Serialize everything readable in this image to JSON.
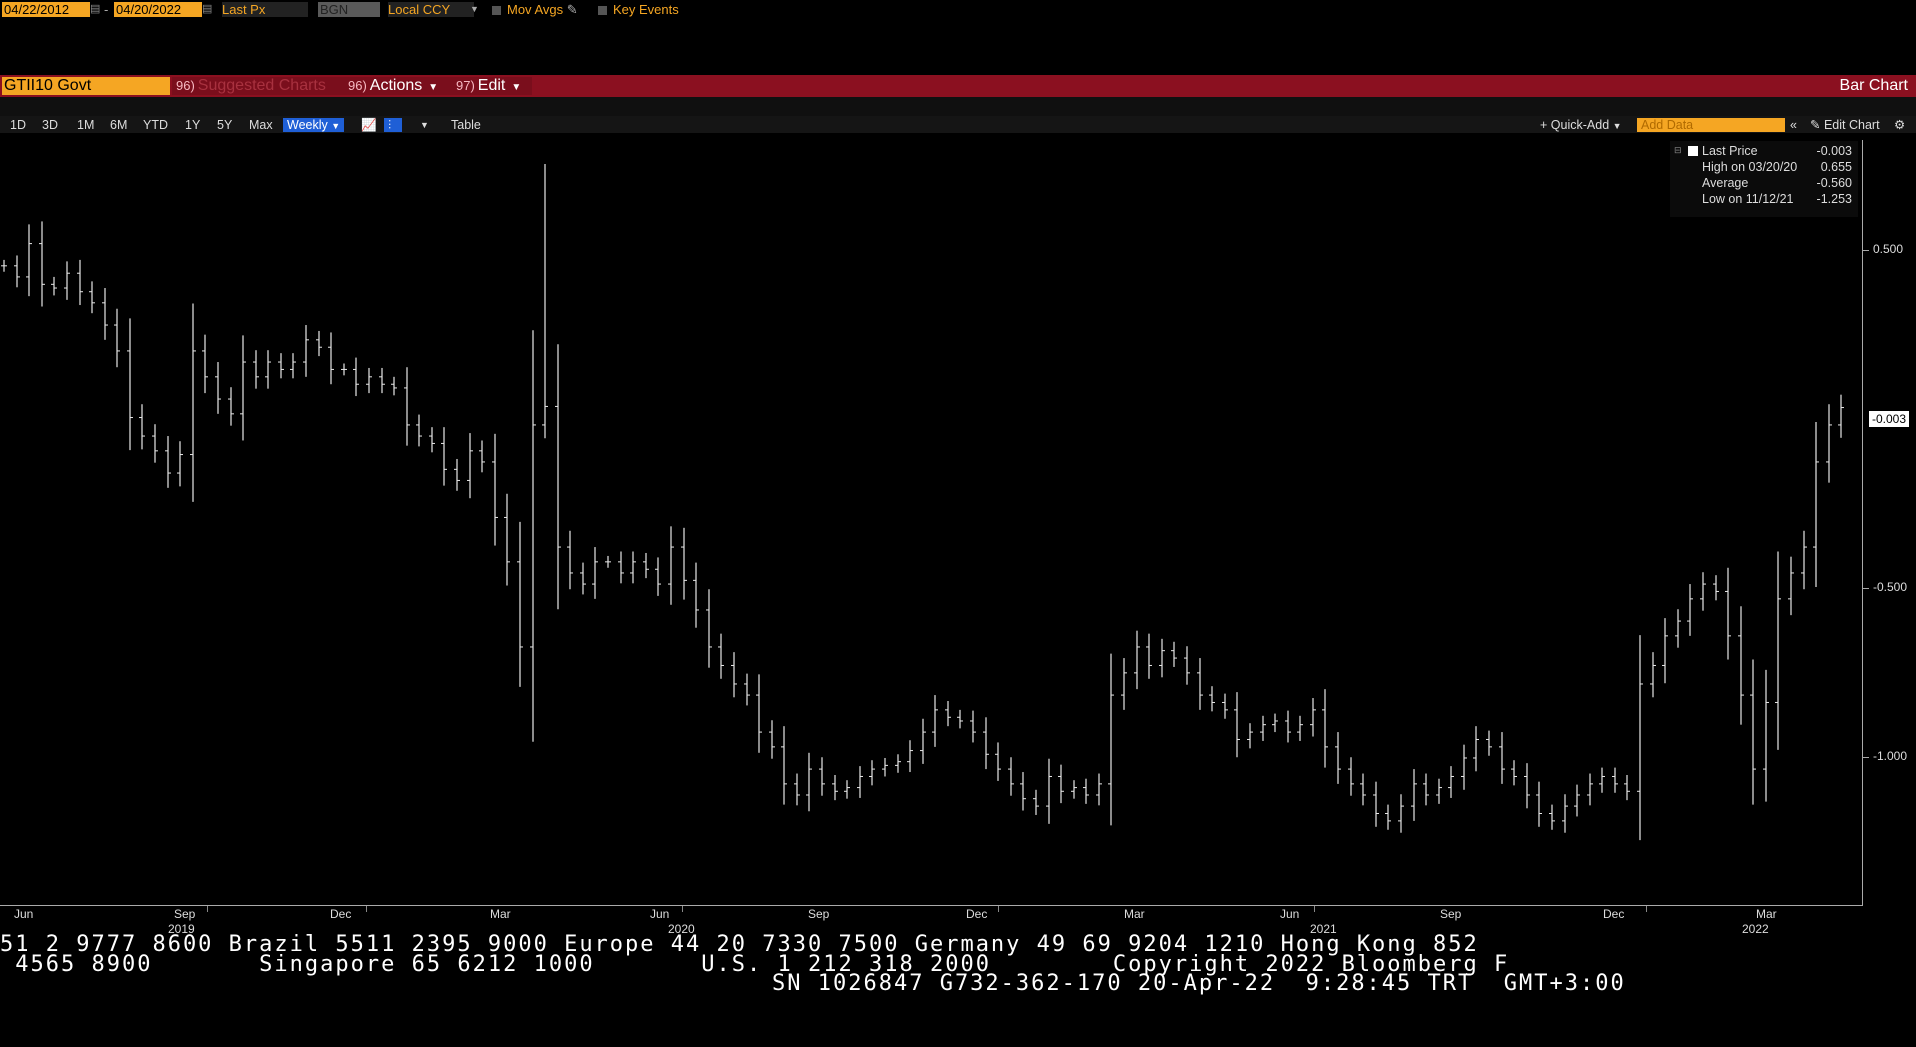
{
  "toolbar": {
    "security": "GTII10 Govt",
    "suggested_num": "96)",
    "suggested_label": "Suggested Charts",
    "actions_num": "96)",
    "actions_label": "Actions",
    "edit_num": "97)",
    "edit_label": "Edit",
    "chart_type": "Bar Chart"
  },
  "settings": {
    "start_date": "04/22/2012",
    "end_date": "04/20/2022",
    "separator": "-",
    "field": "Last Px",
    "source": "BGN",
    "currency": "Local CCY",
    "mov_avgs": "Mov Avgs",
    "key_events": "Key Events"
  },
  "periods": [
    "1D",
    "3D",
    "1M",
    "6M",
    "YTD",
    "1Y",
    "5Y",
    "Max"
  ],
  "frequency": "Weekly",
  "table_label": "Table",
  "quick_add": "Quick-Add",
  "add_data_placeholder": "Add Data",
  "edit_chart": "Edit Chart",
  "legend": {
    "last_label": "Last Price",
    "last_value": "-0.003",
    "high_label": "High on 03/20/20",
    "high_value": "0.655",
    "avg_label": "Average",
    "avg_value": "-0.560",
    "low_label": "Low on 11/12/21",
    "low_value": "-1.253"
  },
  "last_marker": "-0.003",
  "chart_data": {
    "type": "bar",
    "subtype": "ohlc-weekly",
    "y_ticks": [
      "0.500",
      "-0.500",
      "-1.000"
    ],
    "y_tick_values": [
      0.5,
      -0.5,
      -1.0
    ],
    "x_labels": [
      "Jun",
      "Sep",
      "Dec",
      "Mar",
      "Jun",
      "Sep",
      "Dec",
      "Mar",
      "Jun",
      "Sep",
      "Dec",
      "Mar"
    ],
    "year_labels": [
      "2019",
      "2020",
      "2021",
      "2022"
    ],
    "ylim": [
      -1.35,
      0.72
    ],
    "close_series": [
      0.38,
      0.35,
      0.44,
      0.33,
      0.32,
      0.36,
      0.31,
      0.28,
      0.22,
      0.15,
      -0.03,
      -0.08,
      -0.12,
      -0.18,
      -0.13,
      0.15,
      0.08,
      0.02,
      -0.02,
      0.12,
      0.08,
      0.12,
      0.1,
      0.12,
      0.18,
      0.16,
      0.1,
      0.1,
      0.06,
      0.08,
      0.06,
      0.05,
      -0.05,
      -0.08,
      -0.1,
      -0.17,
      -0.2,
      -0.12,
      -0.15,
      -0.3,
      -0.42,
      -0.65,
      -0.05,
      0.0,
      -0.38,
      -0.45,
      -0.48,
      -0.42,
      -0.42,
      -0.45,
      -0.42,
      -0.44,
      -0.48,
      -0.38,
      -0.47,
      -0.55,
      -0.65,
      -0.7,
      -0.75,
      -0.78,
      -0.88,
      -0.92,
      -1.02,
      -1.05,
      -0.98,
      -1.02,
      -1.04,
      -1.03,
      -1.0,
      -0.98,
      -0.97,
      -0.96,
      -0.93,
      -0.88,
      -0.82,
      -0.84,
      -0.85,
      -0.88,
      -0.94,
      -0.98,
      -1.02,
      -1.06,
      -1.08,
      -1.0,
      -1.04,
      -1.03,
      -1.05,
      -1.02,
      -0.78,
      -0.72,
      -0.65,
      -0.7,
      -0.66,
      -0.68,
      -0.72,
      -0.78,
      -0.8,
      -0.82,
      -0.9,
      -0.88,
      -0.86,
      -0.85,
      -0.88,
      -0.86,
      -0.82,
      -0.92,
      -0.98,
      -1.02,
      -1.05,
      -1.1,
      -1.12,
      -1.08,
      -1.02,
      -1.05,
      -1.03,
      -1.0,
      -0.95,
      -0.9,
      -0.92,
      -0.98,
      -1.0,
      -1.05,
      -1.1,
      -1.12,
      -1.08,
      -1.05,
      -1.02,
      -1.0,
      -1.02,
      -1.04,
      -0.75,
      -0.7,
      -0.62,
      -0.58,
      -0.52,
      -0.48,
      -0.5,
      -0.62,
      -0.78,
      -0.98,
      -0.8,
      -0.52,
      -0.45,
      -0.38,
      -0.15,
      -0.05,
      -0.003
    ]
  },
  "footer": {
    "line1": "51 2 9777 8600 Brazil 5511 2395 9000 Europe 44 20 7330 7500 Germany 49 69 9204 1210 Hong Kong 852",
    "line2": " 4565 8900       Singapore 65 6212 1000       U.S. 1 212 318 2000        Copyright 2022 Bloomberg F",
    "line3": "SN 1026847 G732-362-170 20-Apr-22  9:28:45 TRT  GMT+3:00"
  }
}
